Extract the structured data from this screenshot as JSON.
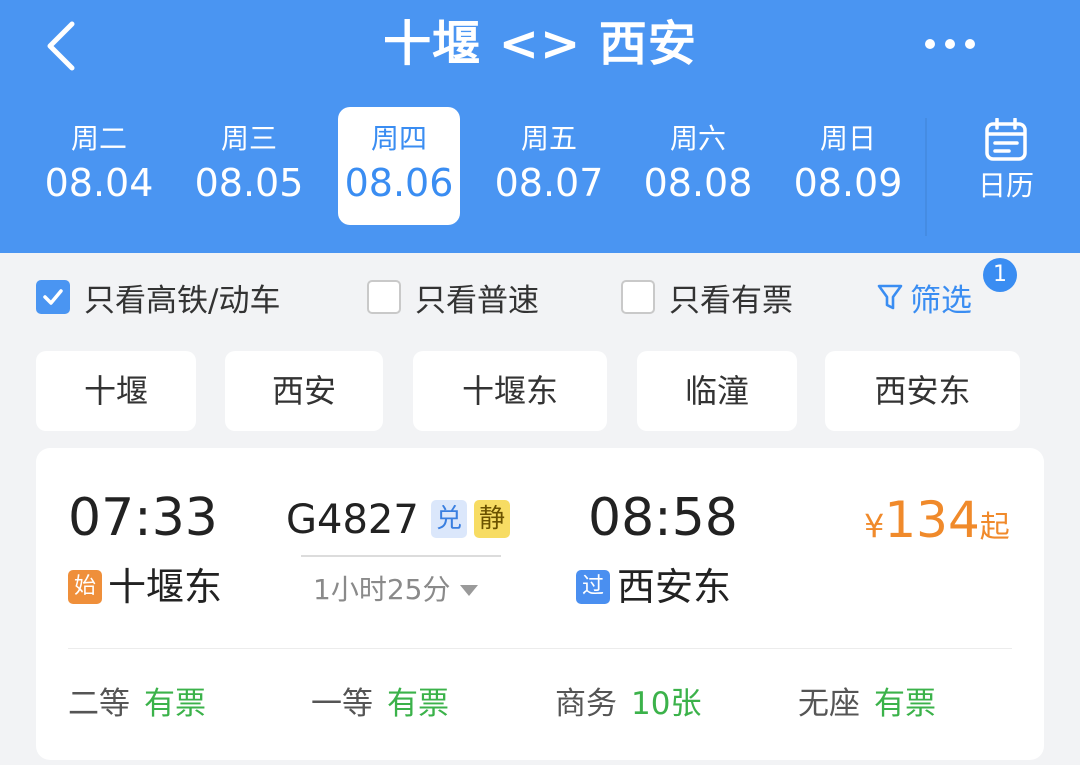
{
  "header": {
    "title": "十堰 <> 西安",
    "back_icon": "chevron-left-icon",
    "more_icon": "more-dots-icon",
    "bg_color": "#4a95f2"
  },
  "dates": [
    {
      "weekday": "周二",
      "date": "08.04",
      "active": false
    },
    {
      "weekday": "周三",
      "date": "08.05",
      "active": false
    },
    {
      "weekday": "周四",
      "date": "08.06",
      "active": true
    },
    {
      "weekday": "周五",
      "date": "08.07",
      "active": false
    },
    {
      "weekday": "周六",
      "date": "08.08",
      "active": false
    },
    {
      "weekday": "周日",
      "date": "08.09",
      "active": false
    }
  ],
  "calendar": {
    "label": "日历",
    "icon": "calendar-icon"
  },
  "filters": {
    "high_speed": {
      "label": "只看高铁/动车",
      "checked": true
    },
    "normal": {
      "label": "只看普速",
      "checked": false
    },
    "has_ticket": {
      "label": "只看有票",
      "checked": false
    },
    "filter_label": "筛选",
    "filter_icon": "funnel-icon",
    "filter_badge": "1"
  },
  "stations": [
    "十堰",
    "西安",
    "十堰东",
    "临潼",
    "西安东"
  ],
  "train": {
    "depart_time": "07:33",
    "arrive_time": "08:58",
    "number": "G4827",
    "tag_exchange": "兑",
    "tag_quiet": "静",
    "duration": "1小时25分",
    "from_badge": "始",
    "from_station": "十堰东",
    "to_badge": "过",
    "to_station": "西安东",
    "price_symbol": "¥",
    "price": "134",
    "price_suffix": "起",
    "price_color": "#f08a2b",
    "seats": [
      {
        "name": "二等",
        "status": "有票"
      },
      {
        "name": "一等",
        "status": "有票"
      },
      {
        "name": "商务",
        "status": "10张"
      },
      {
        "name": "无座",
        "status": "有票"
      }
    ]
  }
}
